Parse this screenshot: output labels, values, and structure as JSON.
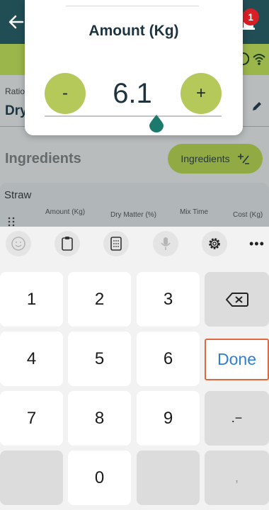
{
  "header": {
    "notification_count": "1",
    "back_icon": "arrow-left-icon",
    "bell_icon": "bell-icon"
  },
  "status": {
    "icons": [
      "sync-icon",
      "wifi-icon"
    ],
    "bar_color": "#9bb64a"
  },
  "ration": {
    "label": "Ratio",
    "value": "Dry"
  },
  "ingredients": {
    "heading": "Ingredients",
    "button_label": "Ingredients",
    "button_icon": "plus-minus-icon"
  },
  "ingredient_card": {
    "title": "Straw",
    "columns": [
      "Amount (Kg)",
      "Dry Matter (%)",
      "Mix Time",
      "Cost (Kg)"
    ]
  },
  "modal": {
    "title": "Amount (Kg)",
    "value": "6.1",
    "minus_label": "-",
    "plus_label": "+",
    "accent": "#b4c95a",
    "cursor_color": "#1b7a6b"
  },
  "keyboard": {
    "toolbar_icons": [
      "emoji-icon",
      "clipboard-icon",
      "keypad-icon",
      "microphone-icon",
      "settings-icon",
      "more-icon"
    ],
    "more_label": "•••",
    "keys": {
      "one": "1",
      "two": "2",
      "three": "3",
      "four": "4",
      "five": "5",
      "six": "6",
      "seven": "7",
      "eight": "8",
      "nine": "9",
      "zero": "0",
      "dot_minus": ".−",
      "comma": ","
    },
    "done_label": "Done",
    "done_color": "#2e7fd4",
    "highlight_color": "#e0683f"
  }
}
